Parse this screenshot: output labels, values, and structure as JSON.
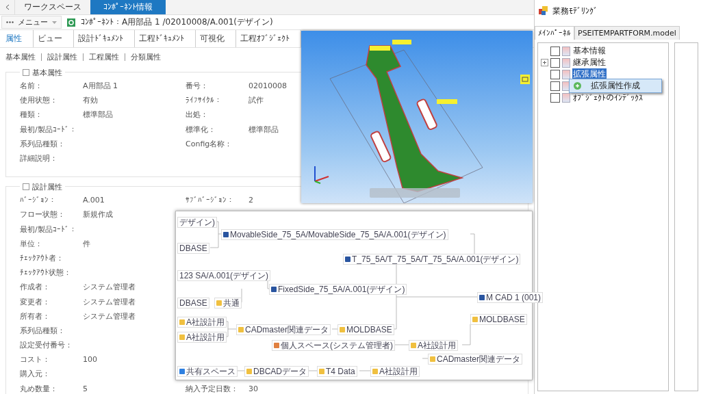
{
  "top_tabs": [
    {
      "label": "ワークスペース",
      "selected": false
    },
    {
      "label": "ｺﾝﾎﾟｰﾈﾝﾄ情報",
      "selected": true
    }
  ],
  "menu": {
    "label": "メニュー",
    "breadcrumb": "ｺﾝﾎﾟｰﾈﾝﾄ：A用部品 1 /02010008/A.001(デザイン)"
  },
  "tabs": [
    {
      "label": "属性",
      "selected": true
    },
    {
      "label": "ビュー",
      "selected": false
    },
    {
      "label": "設計ﾄﾞｷｭﾒﾝﾄ",
      "selected": false
    },
    {
      "label": "工程ﾄﾞｷｭﾒﾝﾄ",
      "selected": false
    },
    {
      "label": "可視化",
      "selected": false
    },
    {
      "label": "工程ｵﾌﾞｼﾞｪｸﾄ",
      "selected": false
    }
  ],
  "sub_links": [
    "基本属性",
    "設計属性",
    "工程属性",
    "分類属性"
  ],
  "sections": [
    {
      "title": "基本属性",
      "rows": [
        {
          "label": "名前：",
          "value": "A用部品 1",
          "label2": "番号：",
          "value2": "02010008"
        },
        {
          "label": "使用状態：",
          "value": "有効",
          "label2": "ﾗｲﾌｻｲｸﾙ：",
          "value2": "試作"
        },
        {
          "label": "種類：",
          "value": "標準部品",
          "label2": "出処："
        },
        {
          "label": "最初/製品ｺｰﾄﾞ：",
          "label2": "標準化：",
          "value2": "標準部品"
        },
        {
          "label": "系列品種類：",
          "label2": "Config名称："
        },
        {
          "label": "詳細説明："
        }
      ]
    },
    {
      "title": "設計属性",
      "rows": [
        {
          "label": "ﾊﾞｰｼﾞｮﾝ：",
          "value": "A.001",
          "label2": "ｻﾌﾞﾊﾞｰｼﾞｮﾝ：",
          "value2": "2"
        },
        {
          "label": "フロー状態：",
          "value": "新規作成"
        },
        {
          "label": "最初/製品ｺｰﾄﾞ："
        },
        {
          "label": "単位：",
          "value": "件"
        },
        {
          "label": "ﾁｪｯｸｱｳﾄ者："
        },
        {
          "label": "ﾁｪｯｸｱｳﾄ状態："
        },
        {
          "label": "作成者：",
          "value": "システム管理者"
        },
        {
          "label": "変更者：",
          "value": "システム管理者"
        },
        {
          "label": "所有者：",
          "value": "システム管理者"
        },
        {
          "label": "系列品種類："
        },
        {
          "label": "設定受付番号："
        },
        {
          "label": "コスト：",
          "value": "100"
        },
        {
          "label": "購入元："
        },
        {
          "label": "丸め数量：",
          "value": "5",
          "label2": "納入予定日数：",
          "value2": "30"
        }
      ]
    }
  ],
  "diagram": {
    "nodes": [
      {
        "label": "デザイン)",
        "kind": "plain"
      },
      {
        "label": "MovableSide_75_5A/MovableSide_75_5A/A.001(デザイン)",
        "kind": "part"
      },
      {
        "label": "DBASE",
        "kind": "plain"
      },
      {
        "label": "T_75_5A/T_75_5A/T_75_5A/A.001(デザイン)",
        "kind": "part"
      },
      {
        "label": "123 SA/A.001(デザイン)",
        "kind": "plain"
      },
      {
        "label": "FixedSide_75_5A/A.001(デザイン)",
        "kind": "part"
      },
      {
        "label": "M CAD 1 (001)",
        "kind": "part"
      },
      {
        "label": "DBASE",
        "kind": "plain"
      },
      {
        "label": "共通",
        "kind": "folder"
      },
      {
        "label": "MOLDBASE",
        "kind": "folder"
      },
      {
        "label": "A社設計用",
        "kind": "folder"
      },
      {
        "label": "CADmaster関連データ",
        "kind": "folder"
      },
      {
        "label": "MOLDBASE",
        "kind": "folder"
      },
      {
        "label": "A社設計用",
        "kind": "folder"
      },
      {
        "label": "個人スペース(システム管理者)",
        "kind": "personal"
      },
      {
        "label": "A社設計用",
        "kind": "folder"
      },
      {
        "label": "CADmaster関連データ",
        "kind": "folder"
      },
      {
        "label": "共有スペース",
        "kind": "shared"
      },
      {
        "label": "DBCADデータ",
        "kind": "folder"
      },
      {
        "label": "T4 Data",
        "kind": "folder"
      },
      {
        "label": "A社設計用",
        "kind": "folder"
      }
    ]
  },
  "right_panel": {
    "title": "業務ﾓﾃﾞﾘﾝｸﾞ",
    "tabs": [
      {
        "label": "ﾒｲﾝﾊﾟｰﾈﾙ",
        "selected": true
      },
      {
        "label": "PSEITEMPARTFORM.model",
        "selected": false
      }
    ],
    "tree": [
      {
        "label": "基本情報",
        "expandable": false,
        "selected": false,
        "checked": false
      },
      {
        "label": "継承属性",
        "expandable": true,
        "selected": false,
        "checked": false
      },
      {
        "label": "拡張属性",
        "expandable": false,
        "selected": true,
        "checked": false
      },
      {
        "expandable": false,
        "selected": false,
        "checked": false
      },
      {
        "label": "ｵﾌﾞｼﾞｪｸﾄのｲﾝﾃﾞｯｸｽ",
        "expandable": false,
        "selected": false,
        "checked": false
      }
    ],
    "context_menu": [
      "拡張属性作成"
    ]
  }
}
